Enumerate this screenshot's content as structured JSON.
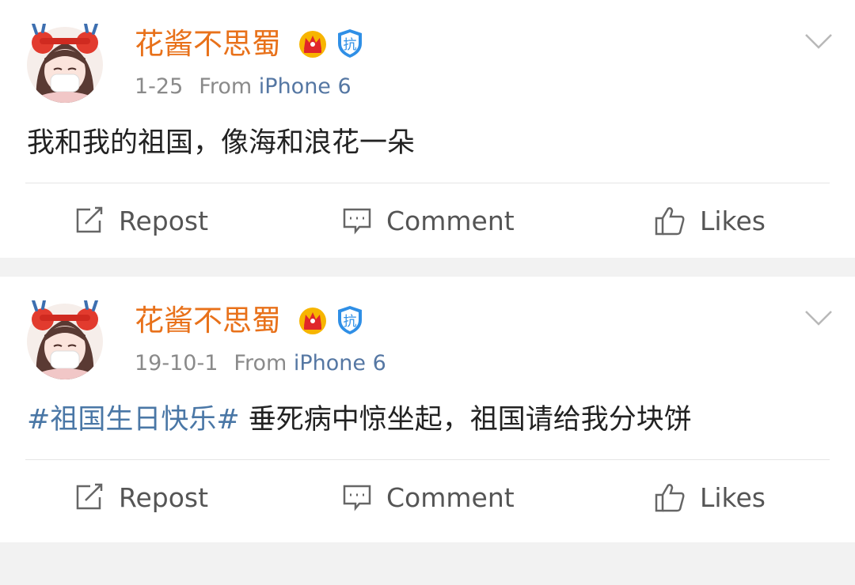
{
  "colors": {
    "username": "#e8711a",
    "link": "#4a77a6",
    "meta": "#8a8a8a",
    "background": "#f2f2f2",
    "card": "#ffffff"
  },
  "posts": [
    {
      "username": "花酱不思蜀",
      "date": "1-25",
      "from_label": "From",
      "source": "iPhone 6",
      "hashtag": "",
      "text": "我和我的祖国，像海和浪花一朵",
      "actions": {
        "repost": "Repost",
        "comment": "Comment",
        "likes": "Likes"
      },
      "badges": [
        "crown-badge-icon",
        "shield-badge-icon"
      ],
      "badge_shield_char": "抗"
    },
    {
      "username": "花酱不思蜀",
      "date": "19-10-1",
      "from_label": "From",
      "source": "iPhone 6",
      "hashtag": "#祖国生日快乐#",
      "text": " 垂死病中惊坐起，祖国请给我分块饼",
      "actions": {
        "repost": "Repost",
        "comment": "Comment",
        "likes": "Likes"
      },
      "badges": [
        "crown-badge-icon",
        "shield-badge-icon"
      ],
      "badge_shield_char": "抗"
    }
  ]
}
